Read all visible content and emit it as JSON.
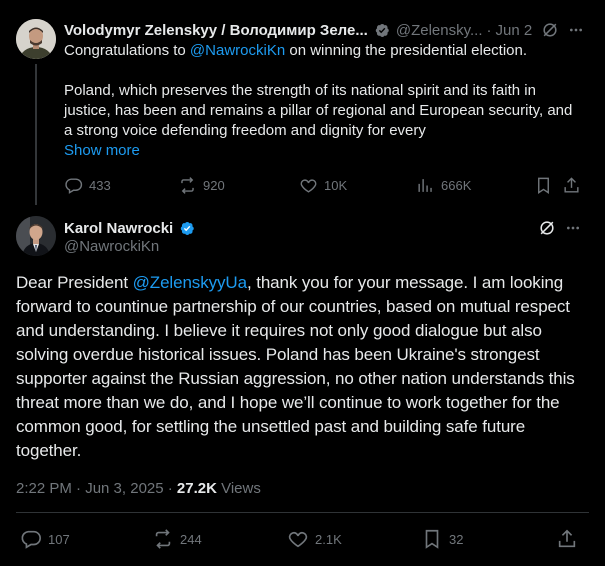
{
  "parent_tweet": {
    "author_name": "Volodymyr Zelenskyy / Володимир Зеле...",
    "author_handle": "@Zelensky...",
    "date": "Jun 2",
    "dot": "·",
    "text_prefix": "Congratulations to ",
    "mention": "@NawrockiKn",
    "text_suffix": " on winning the presidential election.",
    "paragraph2": "Poland, which preserves the strength of its national spirit and its faith in justice, has been and remains a pillar of regional and European security, and a strong voice defending freedom and dignity for every",
    "show_more": "Show more",
    "actions": {
      "replies": "433",
      "reposts": "920",
      "likes": "10K",
      "views": "666K"
    }
  },
  "main_tweet": {
    "author_name": "Karol Nawrocki",
    "author_handle": "@NawrockiKn",
    "text_prefix": "Dear President ",
    "mention": "@ZelenskyyUa",
    "text_suffix": ", thank you for your message. I am looking forward to countinue partnership of our countries, based on mutual respect and understanding. I believe it requires not only good dialogue but also solving overdue historical issues. Poland has been Ukraine's strongest supporter against the Russian aggression, no other nation understands this threat more than we do, and I hope we’ll continue to work together for the common good, for settling the unsettled past and building safe future together.",
    "time": "2:22 PM · Jun 3, 2025 · ",
    "views_count": "27.2K",
    "views_label": " Views",
    "actions": {
      "replies": "107",
      "reposts": "244",
      "likes": "2.1K",
      "bookmarks": "32"
    }
  },
  "colors": {
    "background": "#000000",
    "text": "#e7e9ea",
    "muted": "#71767b",
    "link": "#1d9bf0",
    "verified": "#1d9bf0",
    "divider": "#2f3336"
  },
  "icons": [
    "verified-badge-icon",
    "grok-icon",
    "more-icon",
    "reply-icon",
    "repost-icon",
    "like-icon",
    "views-icon",
    "bookmark-icon",
    "share-icon"
  ]
}
